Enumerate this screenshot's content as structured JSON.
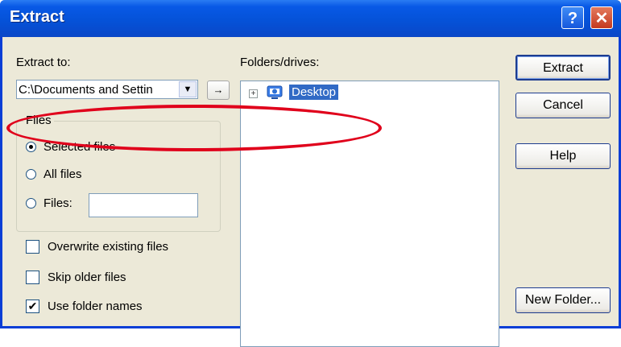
{
  "window": {
    "title": "Extract"
  },
  "titlebar": {
    "help_label": "?",
    "close_label": "✕"
  },
  "extract_to": {
    "label": "Extract to:",
    "path": "C:\\Documents and Settin",
    "dropdown_arrow": "▼",
    "browse_arrow": "→"
  },
  "files_group": {
    "legend": "Files",
    "options": [
      {
        "label": "Selected files",
        "selected": true
      },
      {
        "label": "All files",
        "selected": false
      },
      {
        "label": "Files:",
        "selected": false
      }
    ],
    "files_value": ""
  },
  "checkboxes": [
    {
      "label": "Overwrite existing files",
      "checked": false
    },
    {
      "label": "Skip older files",
      "checked": false
    },
    {
      "label": "Use folder names",
      "checked": true
    }
  ],
  "folders": {
    "label": "Folders/drives:",
    "expander": "+",
    "items": [
      {
        "label": "Desktop",
        "icon": "desktop-icon",
        "selected": true
      }
    ]
  },
  "buttons": {
    "extract": "Extract",
    "cancel": "Cancel",
    "help": "Help",
    "new_folder": "New Folder..."
  },
  "colors": {
    "titlebar": "#0552d8",
    "selection": "#316ac5",
    "annotation": "#e0001b"
  }
}
